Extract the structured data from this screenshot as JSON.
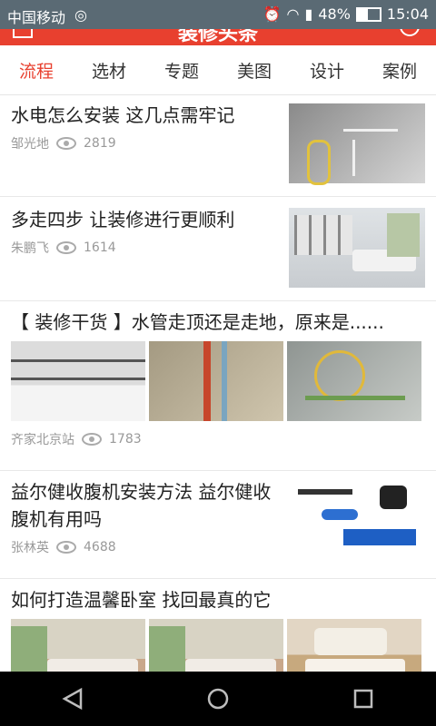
{
  "status_bar": {
    "carrier": "中国移动",
    "battery": "48%",
    "time": "15:04",
    "icons": [
      "signal-icon",
      "alarm-icon",
      "wifi-icon",
      "signal-bars-icon",
      "battery-icon"
    ]
  },
  "app_bar": {
    "title": "装修头条"
  },
  "tabs": [
    "流程",
    "选材",
    "专题",
    "美图",
    "设计",
    "案例"
  ],
  "articles": [
    {
      "title": "水电怎么安装 这几点需牢记",
      "author": "邹光地",
      "views": "2819",
      "layout": "single"
    },
    {
      "title": "多走四步 让装修进行更顺利",
      "author": "朱鹏飞",
      "views": "1614",
      "layout": "single"
    },
    {
      "title": "【 装修干货 】水管走顶还是走地，原来是......",
      "author": "齐家北京站",
      "views": "1783",
      "layout": "triple"
    },
    {
      "title": "益尔健收腹机安装方法 益尔健收腹机有用吗",
      "author": "张林英",
      "views": "4688",
      "layout": "single"
    },
    {
      "title": "如何打造温馨卧室 找回最真的它",
      "author": "",
      "views": "",
      "layout": "triple"
    }
  ],
  "colors": {
    "accent": "#e8402f",
    "statusbar": "#5a6a74"
  }
}
